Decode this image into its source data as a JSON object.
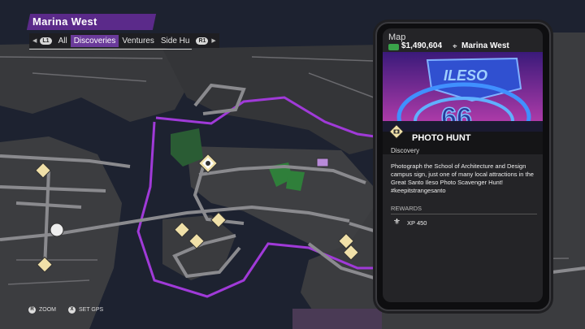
{
  "region": {
    "title": "Marina West"
  },
  "tabs": {
    "left_key": "L1",
    "right_key": "R1",
    "items": [
      "All",
      "Discoveries",
      "Ventures",
      "Side Hu"
    ],
    "active": "Discoveries"
  },
  "panel": {
    "header": "Map",
    "money": "$1,490,604",
    "location": "Marina West",
    "activity_title": "PHOTO HUNT",
    "activity_type": "Discovery",
    "description": "Photograph the School of Architecture and Design campus sign, just one of many local attractions in the Great Santo Ileso Photo Scavenger Hunt! #keepitstrangesanto",
    "rewards_label": "REWARDS",
    "reward_value": "XP 450"
  },
  "hints": {
    "zoom_btn": "R",
    "zoom_label": "ZOOM",
    "gps_btn": "X",
    "gps_label": "SET GPS"
  },
  "colors": {
    "accent_purple": "#a03ad8",
    "map_land": "#3c3d40",
    "map_water": "#1d2230",
    "road": "#8a8a8e",
    "green": "#2f7f3a"
  },
  "icons": [
    "money-icon",
    "location-pin-icon",
    "camera-icon",
    "fleur-de-lis-icon",
    "zoom-button-icon",
    "gps-button-icon"
  ]
}
